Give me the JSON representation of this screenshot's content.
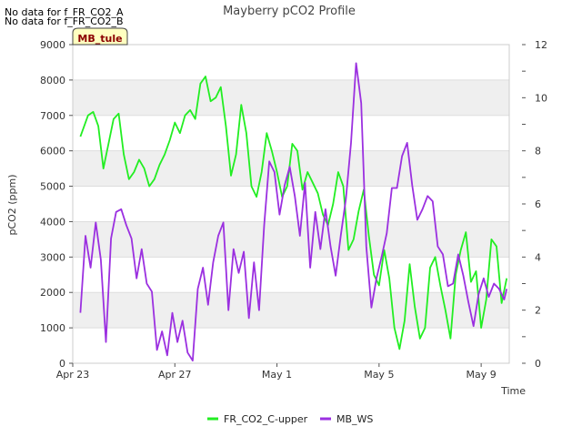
{
  "notices": {
    "no_data_a": "No data for f_FR_CO2_A",
    "no_data_b": "No data for f_FR_CO2_B"
  },
  "site_tag": "MB_tule",
  "chart_data": {
    "type": "line",
    "title": "Mayberry pCO2 Profile",
    "xlabel": "Time",
    "ylabel": "pCO2 (ppm)",
    "ylim": [
      0,
      9000
    ],
    "y2lim": [
      0,
      12
    ],
    "xlim": [
      0,
      17.1
    ],
    "x_ticks": [
      {
        "label": "Apr 23",
        "day": 0
      },
      {
        "label": "Apr 27",
        "day": 4
      },
      {
        "label": "May 1",
        "day": 8
      },
      {
        "label": "May 5",
        "day": 12
      },
      {
        "label": "May 9",
        "day": 16
      }
    ],
    "y_ticks": [
      0,
      1000,
      2000,
      3000,
      4000,
      5000,
      6000,
      7000,
      8000,
      9000
    ],
    "y2_ticks": [
      0,
      2,
      4,
      6,
      8,
      10,
      12
    ],
    "grid": "horizontal bands",
    "legend_position": "bottom",
    "series": [
      {
        "name": "FR_CO2_C-upper",
        "color": "#22ee22",
        "axis": "left",
        "x": [
          0.3,
          0.6,
          0.8,
          1.0,
          1.2,
          1.4,
          1.6,
          1.8,
          2.0,
          2.2,
          2.4,
          2.6,
          2.8,
          3.0,
          3.2,
          3.4,
          3.6,
          3.8,
          4.0,
          4.2,
          4.4,
          4.6,
          4.8,
          5.0,
          5.2,
          5.4,
          5.6,
          5.8,
          6.0,
          6.2,
          6.4,
          6.6,
          6.8,
          7.0,
          7.2,
          7.4,
          7.6,
          7.8,
          8.0,
          8.2,
          8.4,
          8.6,
          8.8,
          9.0,
          9.2,
          9.4,
          9.6,
          9.8,
          10.0,
          10.2,
          10.4,
          10.6,
          10.8,
          11.0,
          11.2,
          11.4,
          11.6,
          11.8,
          12.0,
          12.2,
          12.4,
          12.6,
          12.8,
          13.0,
          13.2,
          13.4,
          13.6,
          13.8,
          14.0,
          14.2,
          14.4,
          14.6,
          14.8,
          15.0,
          15.2,
          15.4,
          15.6,
          15.8,
          16.0,
          16.2,
          16.4,
          16.6,
          16.8,
          17.0
        ],
        "values": [
          6400,
          7000,
          7100,
          6700,
          5500,
          6200,
          6900,
          7050,
          5900,
          5200,
          5400,
          5750,
          5500,
          5000,
          5200,
          5600,
          5900,
          6300,
          6800,
          6500,
          7000,
          7150,
          6900,
          7900,
          8100,
          7400,
          7500,
          7800,
          6700,
          5300,
          5900,
          7300,
          6500,
          5000,
          4700,
          5400,
          6500,
          6000,
          5400,
          4700,
          5000,
          6200,
          6000,
          4900,
          5400,
          5100,
          4800,
          4200,
          3900,
          4500,
          5400,
          5000,
          3200,
          3500,
          4300,
          4900,
          3600,
          2500,
          2200,
          3200,
          2400,
          1000,
          400,
          1200,
          2800,
          1600,
          700,
          1000,
          2700,
          3000,
          2200,
          1500,
          700,
          2500,
          3200,
          3700,
          2300,
          2600,
          1000,
          1800,
          3500,
          3300,
          1700,
          2400
        ]
      },
      {
        "name": "MB_WS",
        "color": "#9b30e0",
        "axis": "right",
        "x": [
          0.3,
          0.5,
          0.7,
          0.9,
          1.1,
          1.3,
          1.5,
          1.7,
          1.9,
          2.1,
          2.3,
          2.5,
          2.7,
          2.9,
          3.1,
          3.3,
          3.5,
          3.7,
          3.9,
          4.1,
          4.3,
          4.5,
          4.7,
          4.9,
          5.1,
          5.3,
          5.5,
          5.7,
          5.9,
          6.1,
          6.3,
          6.5,
          6.7,
          6.9,
          7.1,
          7.3,
          7.5,
          7.7,
          7.9,
          8.1,
          8.3,
          8.5,
          8.7,
          8.9,
          9.1,
          9.3,
          9.5,
          9.7,
          9.9,
          10.1,
          10.3,
          10.5,
          10.7,
          10.9,
          11.1,
          11.3,
          11.5,
          11.7,
          11.9,
          12.1,
          12.3,
          12.5,
          12.7,
          12.9,
          13.1,
          13.3,
          13.5,
          13.7,
          13.9,
          14.1,
          14.3,
          14.5,
          14.7,
          14.9,
          15.1,
          15.3,
          15.5,
          15.7,
          15.9,
          16.1,
          16.3,
          16.5,
          16.7,
          16.9,
          17.0
        ],
        "values": [
          1.9,
          4.8,
          3.6,
          5.3,
          3.9,
          0.8,
          4.7,
          5.7,
          5.8,
          5.2,
          4.7,
          3.2,
          4.3,
          3.0,
          2.7,
          0.5,
          1.2,
          0.3,
          1.9,
          0.8,
          1.6,
          0.4,
          0.1,
          2.8,
          3.6,
          2.2,
          3.8,
          4.8,
          5.3,
          2.0,
          4.3,
          3.4,
          4.2,
          1.7,
          3.8,
          2.0,
          5.2,
          7.6,
          7.2,
          5.6,
          6.7,
          7.4,
          6.3,
          4.8,
          6.8,
          3.6,
          5.7,
          4.3,
          5.8,
          4.4,
          3.3,
          4.8,
          6.2,
          8.3,
          11.3,
          9.8,
          4.4,
          2.1,
          3.2,
          4.0,
          4.9,
          6.6,
          6.6,
          7.8,
          8.3,
          6.7,
          5.4,
          5.8,
          6.3,
          6.1,
          4.4,
          4.1,
          2.9,
          3.0,
          4.1,
          3.3,
          2.3,
          1.4,
          2.6,
          3.2,
          2.5,
          3.0,
          2.8,
          2.4,
          2.8
        ]
      }
    ]
  }
}
